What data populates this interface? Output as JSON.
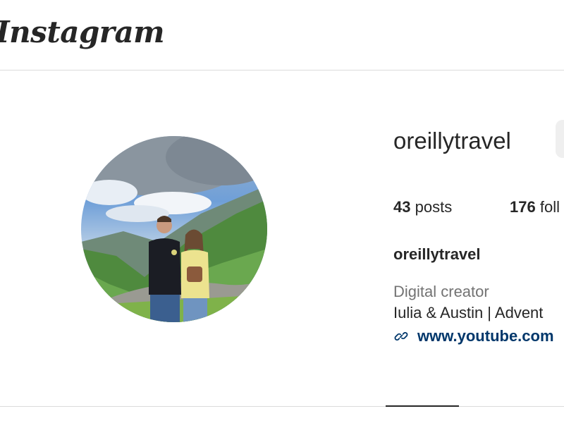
{
  "header": {
    "logo_text": "Instagram"
  },
  "profile": {
    "username": "oreillytravel",
    "stats": {
      "posts_count": "43",
      "posts_label": "posts",
      "followers_count": "176",
      "followers_label": "foll"
    },
    "full_name": "oreillytravel",
    "category": "Digital creator",
    "bio": "Iulia & Austin | Advent",
    "link": "www.youtube.com"
  },
  "icons": {
    "link": "link-icon"
  },
  "colors": {
    "text_primary": "#262626",
    "text_secondary": "#737373",
    "link": "#00376b",
    "border": "#dbdbdb",
    "button_bg": "#efefef"
  }
}
